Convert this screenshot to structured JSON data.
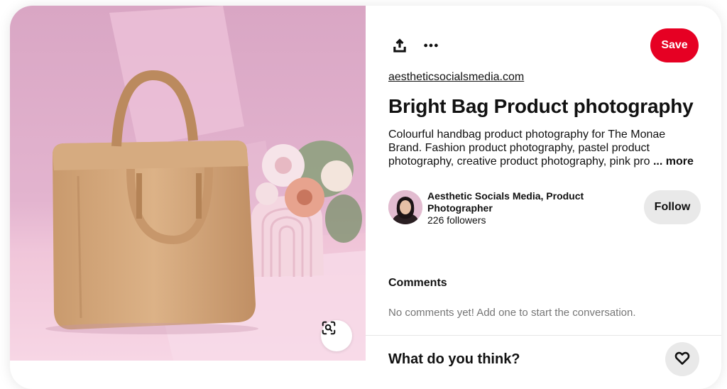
{
  "toolbar": {
    "share_icon": "share-icon",
    "more_icon": "more-icon",
    "save_label": "Save"
  },
  "pin": {
    "source_link": "aestheticsocialsmedia.com",
    "title": "Bright Bag Product photography",
    "description": "Colourful handbag product photography for The Monae Brand. Fashion product photography, pastel product photography, creative product photography, pink pro",
    "description_more": "... more"
  },
  "creator": {
    "name": "Aesthetic Socials Media, Product Photographer",
    "followers": "226 followers",
    "follow_label": "Follow"
  },
  "comments": {
    "heading": "Comments",
    "empty_text": "No comments yet! Add one to start the conversation."
  },
  "footer": {
    "prompt": "What do you think?",
    "react_icon": "heart-icon"
  },
  "colors": {
    "save_button": "#e60023",
    "secondary_button": "#e9e9e9",
    "muted_text": "#767676"
  }
}
